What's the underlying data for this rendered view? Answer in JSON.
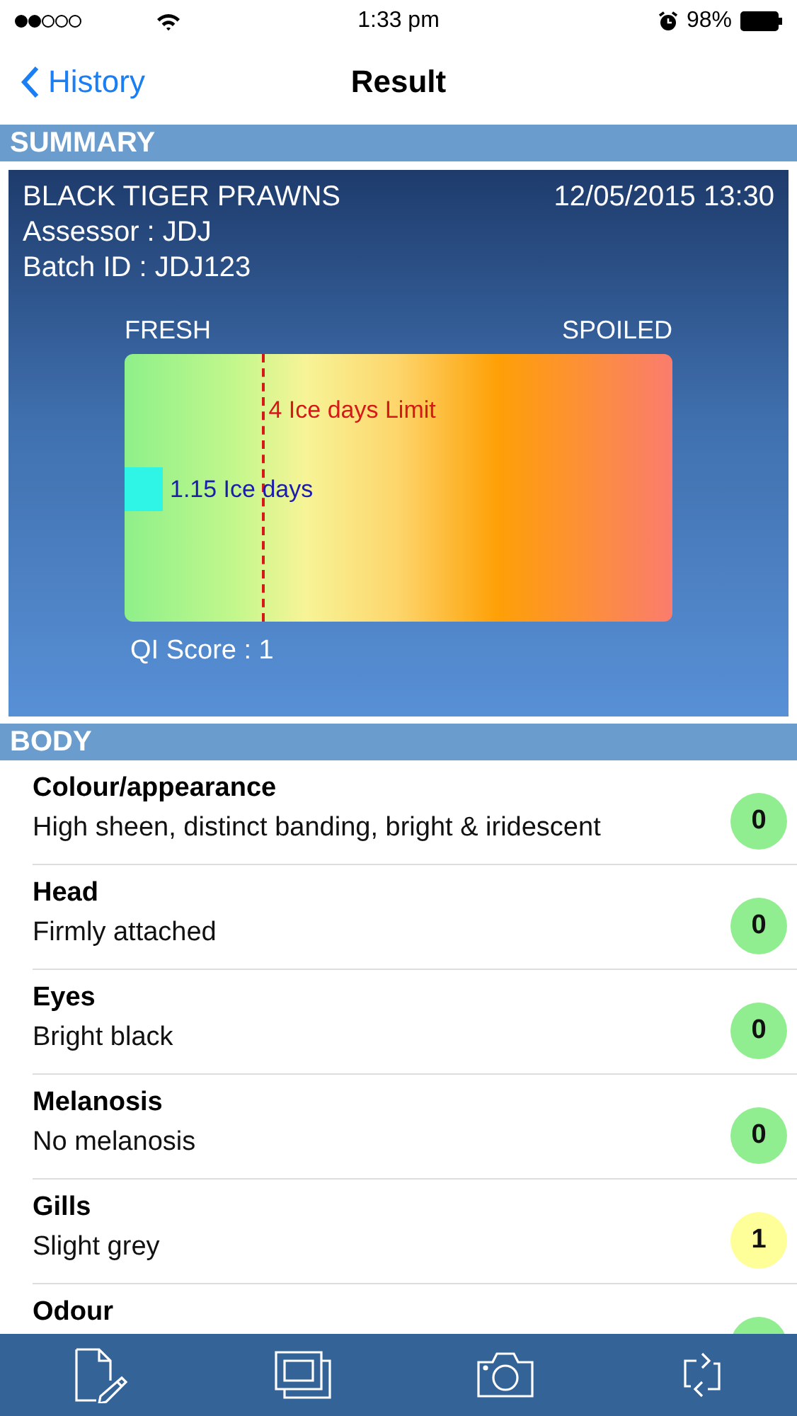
{
  "status_bar": {
    "time": "1:33 pm",
    "battery": "98%"
  },
  "nav": {
    "back": "History",
    "title": "Result"
  },
  "summary": {
    "header": "SUMMARY",
    "product": "BLACK TIGER PRAWNS",
    "datetime": "12/05/2015 13:30",
    "assessor": "Assessor : JDJ",
    "batch": "Batch ID : JDJ123",
    "gauge": {
      "left_label": "FRESH",
      "right_label": "SPOILED",
      "limit": {
        "label": "4 Ice days Limit",
        "level": 0.25
      },
      "marker": {
        "label": "1.15 Ice days",
        "level": 0
      }
    },
    "qi_score": "QI Score : 1"
  },
  "body": {
    "header": "BODY",
    "items": [
      {
        "title": "Colour/appearance",
        "description": "High sheen, distinct banding, bright & iridescent",
        "score": "0",
        "color": "#90ee90"
      },
      {
        "title": "Head",
        "description": "Firmly attached",
        "score": "0",
        "color": "#90ee90"
      },
      {
        "title": "Eyes",
        "description": "Bright black",
        "score": "0",
        "color": "#90ee90"
      },
      {
        "title": "Melanosis",
        "description": "No melanosis",
        "score": "0",
        "color": "#90ee90"
      },
      {
        "title": "Gills",
        "description": "Slight grey",
        "score": "1",
        "color": "#ffff99"
      },
      {
        "title": "Odour",
        "color": "#90ee90"
      }
    ]
  }
}
